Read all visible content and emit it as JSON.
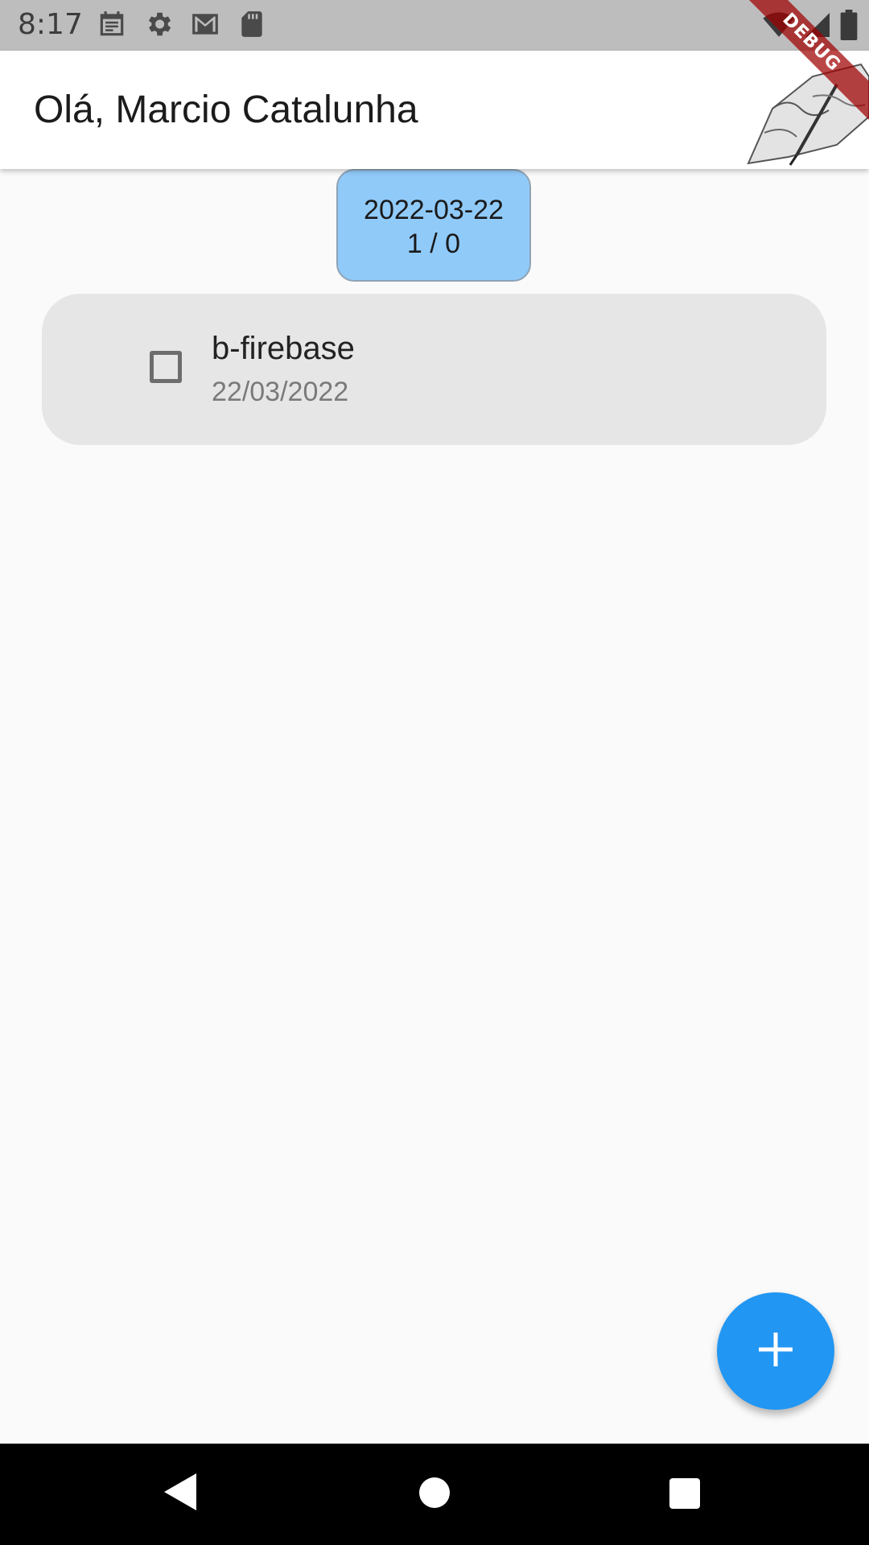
{
  "status_bar": {
    "time": "8:17",
    "left_icons": [
      "calendar-icon",
      "settings-icon",
      "gmail-icon",
      "sd-card-icon"
    ],
    "right_icons": [
      "wifi-icon",
      "signal-icon",
      "battery-icon"
    ]
  },
  "debug_banner": {
    "label": "DEBUG",
    "color": "#a00000"
  },
  "app_bar": {
    "title": "Olá, Marcio Catalunha",
    "logo": "hand-writing-logo"
  },
  "date_chip": {
    "date": "2022-03-22",
    "count": "1 / 0",
    "background": "#90caf9"
  },
  "tasks": [
    {
      "title": "b-firebase",
      "date": "22/03/2022",
      "checked": false
    }
  ],
  "fab": {
    "icon": "add-icon",
    "color": "#2196f3"
  },
  "nav_bar": {
    "buttons": [
      "back-icon",
      "home-icon",
      "recents-icon"
    ]
  }
}
